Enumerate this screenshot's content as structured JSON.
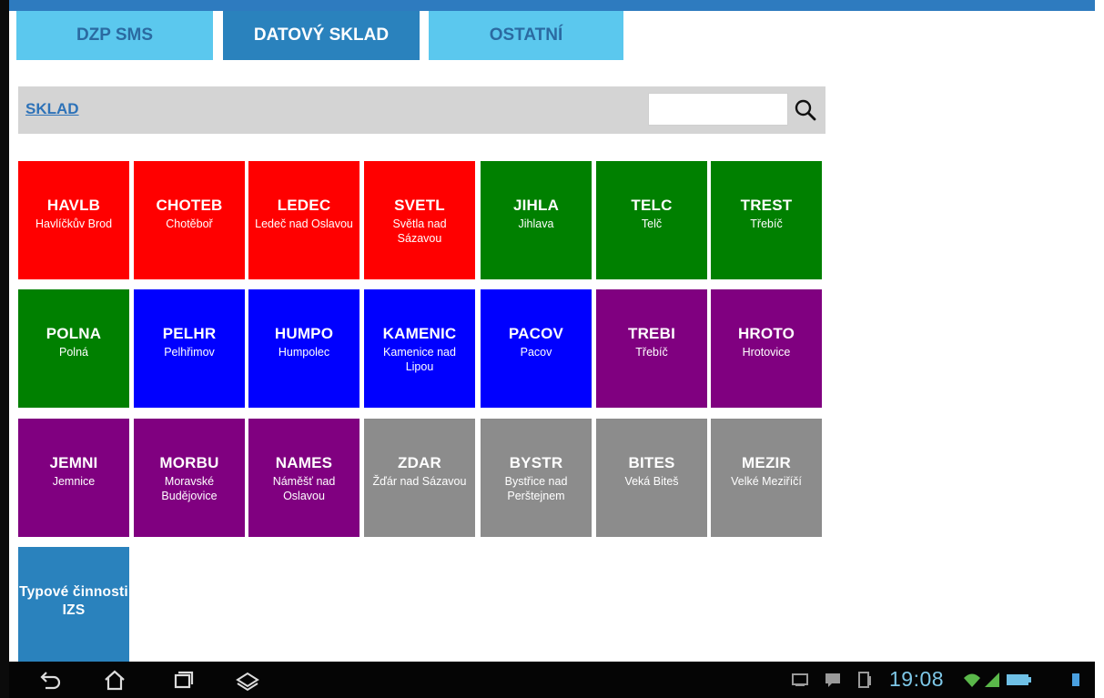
{
  "tabs": [
    {
      "label": "DZP SMS",
      "active": false
    },
    {
      "label": "DATOVÝ SKLAD",
      "active": true
    },
    {
      "label": "OSTATNÍ",
      "active": false
    }
  ],
  "header": {
    "title": "SKLAD",
    "search_value": "",
    "search_icon": "search-icon"
  },
  "colors": {
    "red": "#ff0000",
    "green": "#008000",
    "blue": "#0000ff",
    "purple": "#800080",
    "gray": "#8c8c8c",
    "light_blue": "#2a82bd",
    "tab_bg": "#5bc8ee",
    "tab_active": "#2a82bd",
    "header_bar": "#d4d4d4",
    "link": "#2d72b8"
  },
  "tiles": [
    {
      "code": "HAVLB",
      "name": "Havlíčkův Brod",
      "color": "red"
    },
    {
      "code": "CHOTEB",
      "name": "Chotěboř",
      "color": "red"
    },
    {
      "code": "LEDEC",
      "name": "Ledeč nad Oslavou",
      "color": "red"
    },
    {
      "code": "SVETL",
      "name": "Světla nad Sázavou",
      "color": "red"
    },
    {
      "code": "JIHLA",
      "name": "Jihlava",
      "color": "green"
    },
    {
      "code": "TELC",
      "name": "Telč",
      "color": "green"
    },
    {
      "code": "TREST",
      "name": "Třebíč",
      "color": "green"
    },
    {
      "code": "POLNA",
      "name": "Polná",
      "color": "green"
    },
    {
      "code": "PELHR",
      "name": "Pelhřimov",
      "color": "blue"
    },
    {
      "code": "HUMPO",
      "name": "Humpolec",
      "color": "blue"
    },
    {
      "code": "KAMENIC",
      "name": "Kamenice nad Lipou",
      "color": "blue"
    },
    {
      "code": "PACOV",
      "name": "Pacov",
      "color": "blue"
    },
    {
      "code": "TREBI",
      "name": "Třebíč",
      "color": "purple"
    },
    {
      "code": "HROTO",
      "name": "Hrotovice",
      "color": "purple"
    },
    {
      "code": "JEMNI",
      "name": "Jemnice",
      "color": "purple"
    },
    {
      "code": "MORBU",
      "name": "Moravské Budějovice",
      "color": "purple"
    },
    {
      "code": "NAMES",
      "name": "Náměšť nad Oslavou",
      "color": "purple"
    },
    {
      "code": "ZDAR",
      "name": "Žďár nad Sázavou",
      "color": "gray"
    },
    {
      "code": "BYSTR",
      "name": "Bystřice nad Perštejnem",
      "color": "gray"
    },
    {
      "code": "BITES",
      "name": "Veká Biteš",
      "color": "gray"
    },
    {
      "code": "MEZIR",
      "name": "Velké Meziříčí",
      "color": "gray"
    }
  ],
  "izs_tile": {
    "label": "Typové činnosti IZS",
    "color": "light_blue"
  },
  "navbar": {
    "clock": "19:08",
    "buttons": [
      "back-icon",
      "home-icon",
      "recent-apps-icon",
      "menu-icon"
    ],
    "status_icons": [
      "screenshot-icon",
      "message-icon",
      "usb-icon",
      "wifi-icon",
      "signal-icon",
      "battery-icon"
    ]
  }
}
